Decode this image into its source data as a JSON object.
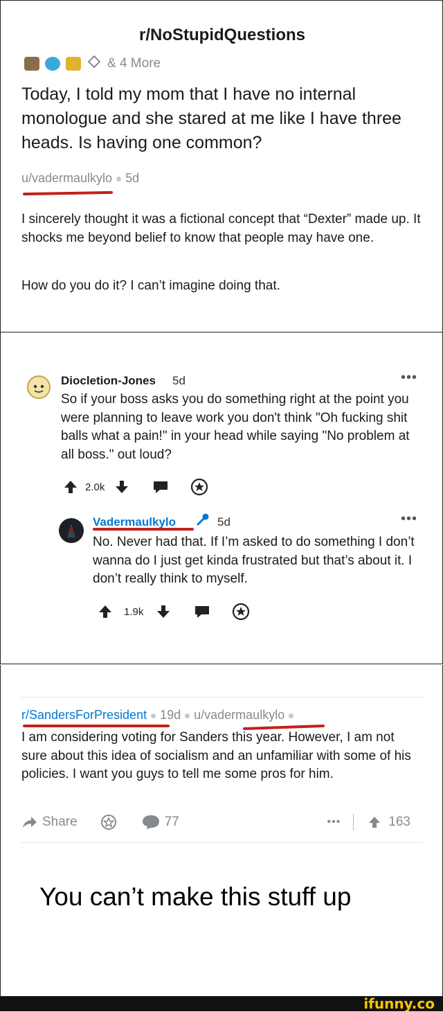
{
  "post": {
    "subreddit": "r/NoStupidQuestions",
    "awards_more": "& 4 More",
    "title": "Today, I told my mom that I have no internal monologue and she stared at me like I have three heads. Is having one common?",
    "author": "u/vadermaulkylo",
    "age": "5d",
    "body_p1": "I sincerely thought it was a fictional concept that “Dexter” made up. It shocks me beyond belief to know that people may have one.",
    "body_p2": "How do you do it? I can’t imagine doing that."
  },
  "comments": [
    {
      "author": "Diocletion-Jones",
      "age": "5d",
      "body": "So if your boss asks you do something right at the point you were planning to leave work you don't think \"Oh fucking shit balls what a pain!\" in your head while saying \"No problem at all boss.\" out loud?",
      "score": "2.0k"
    },
    {
      "author": "Vadermaulkylo",
      "age": "5d",
      "body": "No. Never had that. If I’m asked to do something I don’t wanna do I just get kinda frustrated but that’s about it. I don’t really think to myself.",
      "score": "1.9k"
    }
  ],
  "post2": {
    "subreddit": "r/SandersForPresident",
    "age": "19d",
    "author": "u/vadermaulkylo",
    "body": "I am considering voting for Sanders this year. However, I am not sure about this idea of socialism and an unfamiliar with some of his policies. I want you guys to tell me some pros for him.",
    "share_label": "Share",
    "comments_count": "77",
    "score": "163"
  },
  "caption": "You can’t make this stuff up",
  "watermark": "ifunny.co",
  "colors": {
    "underline_red": "#c0221b",
    "link_blue": "#0079d3",
    "meta_gray": "#878a8c",
    "watermark_yellow": "#f7c600"
  }
}
